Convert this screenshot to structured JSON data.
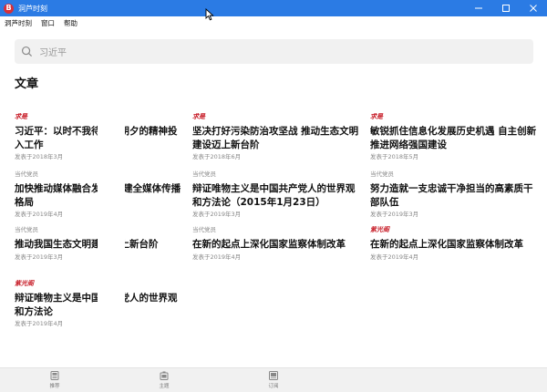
{
  "window": {
    "title": "洞芦时刻",
    "logo_letter": "B",
    "accent": "#2b7be4",
    "logo_color": "#d6303a"
  },
  "menu": {
    "items": [
      "洞芦时刻",
      "窗口",
      "帮助"
    ]
  },
  "search": {
    "value": "习近平"
  },
  "section": {
    "title": "文章"
  },
  "columns": [
    [
      {
        "source": "求是",
        "source_style": "script",
        "title": "习近平：以时不我待只争朝夕的精神投入工作",
        "date": "发表于2018年3月",
        "occluded": true
      },
      {
        "source": "当代党员",
        "source_style": "plain",
        "title": "加快推动媒体融合发展 构建全媒体传播格局",
        "date": "发表于2019年4月",
        "occluded": true
      },
      {
        "source": "当代党员",
        "source_style": "plain",
        "title": "推动我国生态文明建设迈上新台阶",
        "date": "发表于2019年3月",
        "occluded": true
      },
      {
        "source": "紫光阁",
        "source_style": "script",
        "title": "辩证唯物主义是中国共产党人的世界观和方法论",
        "date": "发表于2019年4月",
        "occluded": true
      }
    ],
    [
      {
        "source": "求是",
        "source_style": "script",
        "title": "坚决打好污染防治攻坚战 推动生态文明建设迈上新台阶",
        "date": "发表于2018年6月",
        "occluded": false
      },
      {
        "source": "当代党员",
        "source_style": "plain",
        "title": "辩证唯物主义是中国共产党人的世界观和方法论（2015年1月23日）",
        "date": "发表于2019年3月",
        "occluded": false
      },
      {
        "source": "当代党员",
        "source_style": "plain",
        "title": "在新的起点上深化国家监察体制改革",
        "date": "发表于2019年4月",
        "occluded": false
      }
    ],
    [
      {
        "source": "求是",
        "source_style": "script",
        "title": "敏锐抓住信息化发展历史机遇 自主创新推进网络强国建设",
        "date": "发表于2018年5月",
        "occluded": false
      },
      {
        "source": "当代党员",
        "source_style": "plain",
        "title": "努力造就一支忠诚干净担当的高素质干部队伍",
        "date": "发表于2019年3月",
        "occluded": false
      },
      {
        "source": "紫光阁",
        "source_style": "script",
        "title": "在新的起点上深化国家监察体制改革",
        "date": "发表于2019年4月",
        "occluded": false
      }
    ]
  ],
  "tabs": [
    {
      "label": "推荐",
      "icon": "recommend-icon"
    },
    {
      "label": "主题",
      "icon": "topic-icon"
    },
    {
      "label": "订阅",
      "icon": "subscribe-icon"
    }
  ]
}
